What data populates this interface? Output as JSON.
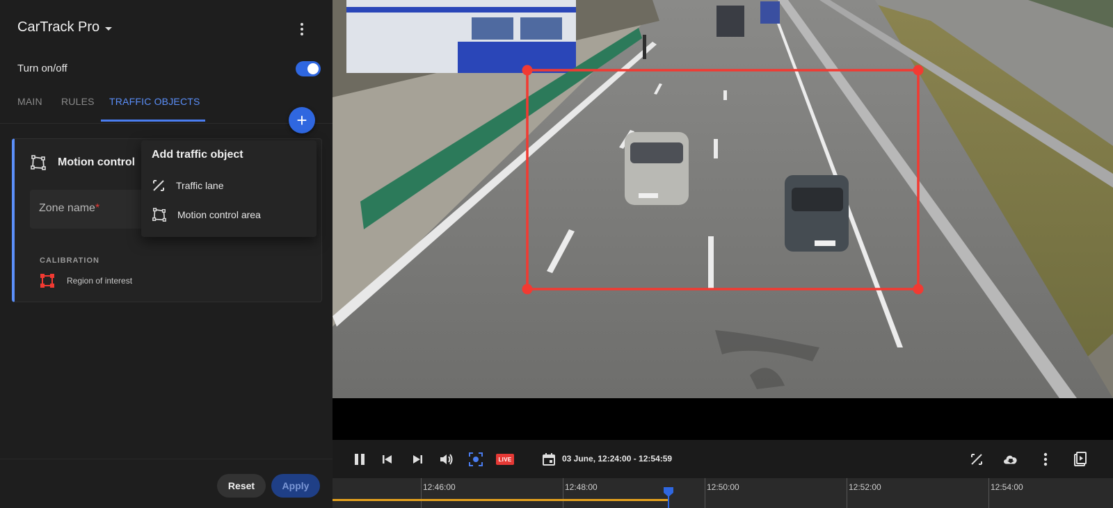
{
  "app": {
    "title": "CarTrack Pro",
    "toggle_label": "Turn on/off",
    "toggle_state": "on"
  },
  "tabs": [
    {
      "label": "MAIN",
      "active": false
    },
    {
      "label": "RULES",
      "active": false
    },
    {
      "label": "TRAFFIC OBJECTS",
      "active": true
    }
  ],
  "add_button_label": "+",
  "object_card": {
    "title": "Motion control",
    "icon": "polygon-icon",
    "zone_name_label": "Zone name",
    "zone_name_required_mark": "*",
    "zone_name_value": "",
    "calibration_label": "CALIBRATION",
    "roi_label": "Region of interest",
    "roi_icon": "roi-square-icon"
  },
  "add_menu": {
    "title": "Add traffic object",
    "items": [
      {
        "label": "Traffic lane",
        "icon": "lane-icon"
      },
      {
        "label": "Motion control area",
        "icon": "polygon-icon"
      }
    ]
  },
  "footer": {
    "reset_label": "Reset",
    "apply_label": "Apply",
    "apply_enabled": false
  },
  "player": {
    "live_label": "LIVE",
    "date_range": "03 June, 12:24:00 - 12:54:59",
    "left_controls": [
      "pause-icon",
      "skip-previous-icon",
      "skip-next-icon",
      "volume-icon",
      "focus-icon"
    ],
    "right_controls": [
      "lane-icon",
      "cloud-download-icon",
      "more-vert-icon",
      "clip-icon"
    ]
  },
  "timeline": {
    "ticks": [
      "12:46:00",
      "12:48:00",
      "12:50:00",
      "12:52:00",
      "12:54:00"
    ]
  },
  "colors": {
    "accent": "#2f67e0",
    "tab_active": "#5b8ff9",
    "roi": "#f23a32",
    "live": "#e53935",
    "recorded": "#e6a21d"
  }
}
